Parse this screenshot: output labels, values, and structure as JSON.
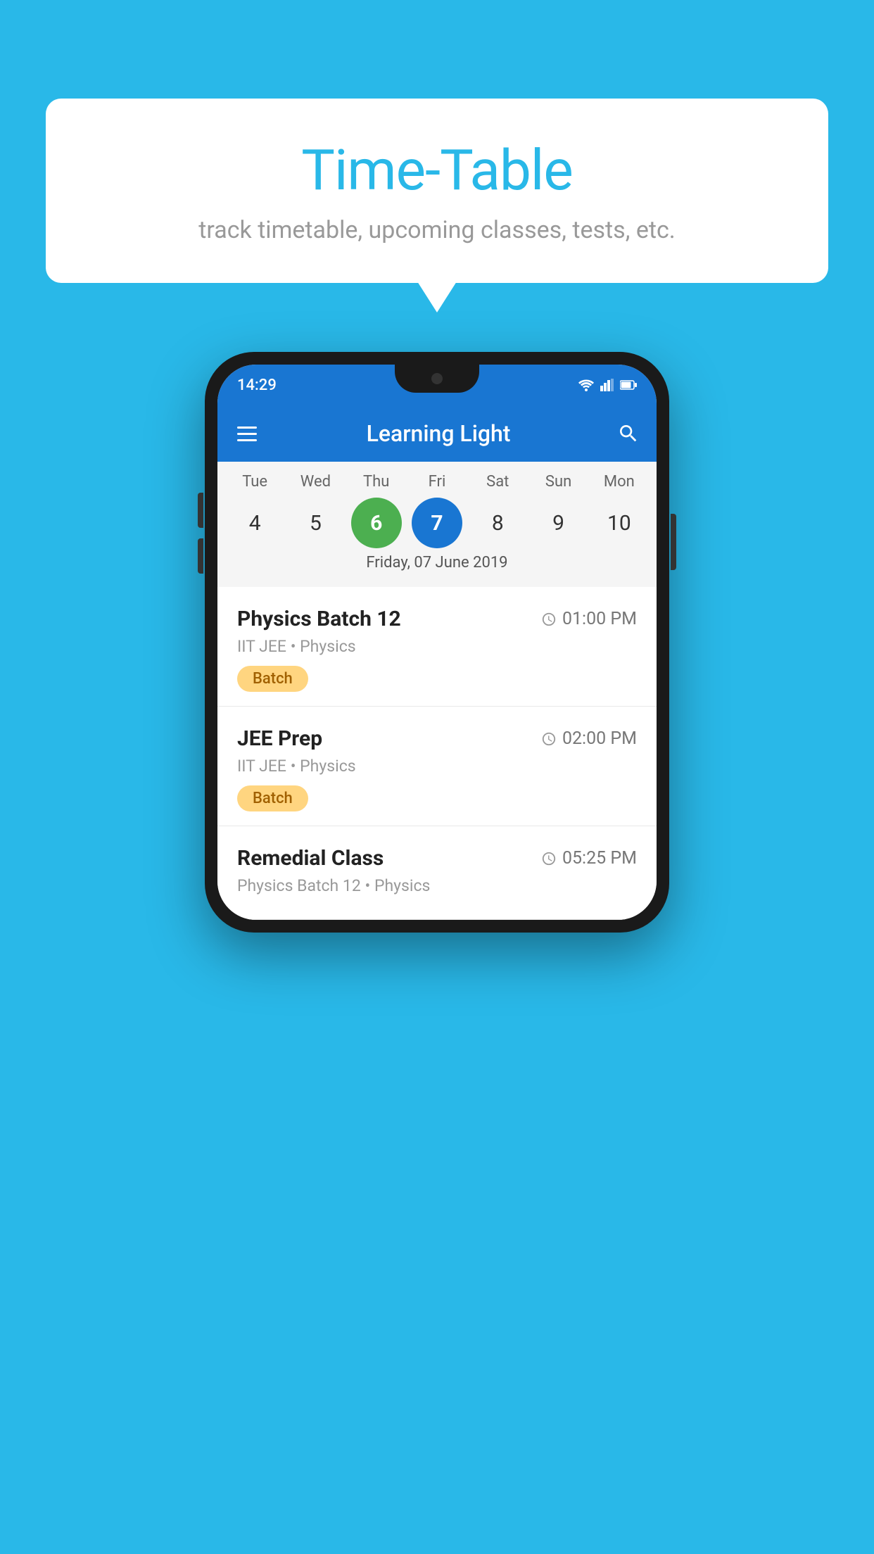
{
  "background_color": "#29b8e8",
  "speech_bubble": {
    "title": "Time-Table",
    "subtitle": "track timetable, upcoming classes, tests, etc."
  },
  "phone": {
    "status_bar": {
      "time": "14:29",
      "icons": [
        "wifi",
        "signal",
        "battery"
      ]
    },
    "app_bar": {
      "title": "Learning Light",
      "menu_label": "menu",
      "search_label": "search"
    },
    "calendar": {
      "days": [
        {
          "label": "Tue",
          "number": "4"
        },
        {
          "label": "Wed",
          "number": "5"
        },
        {
          "label": "Thu",
          "number": "6",
          "state": "today"
        },
        {
          "label": "Fri",
          "number": "7",
          "state": "selected"
        },
        {
          "label": "Sat",
          "number": "8"
        },
        {
          "label": "Sun",
          "number": "9"
        },
        {
          "label": "Mon",
          "number": "10"
        }
      ],
      "selected_date_label": "Friday, 07 June 2019"
    },
    "schedule": [
      {
        "title": "Physics Batch 12",
        "time": "01:00 PM",
        "meta": "IIT JEE • Physics",
        "tag": "Batch"
      },
      {
        "title": "JEE Prep",
        "time": "02:00 PM",
        "meta": "IIT JEE • Physics",
        "tag": "Batch"
      },
      {
        "title": "Remedial Class",
        "time": "05:25 PM",
        "meta": "Physics Batch 12 • Physics",
        "tag": ""
      }
    ]
  }
}
